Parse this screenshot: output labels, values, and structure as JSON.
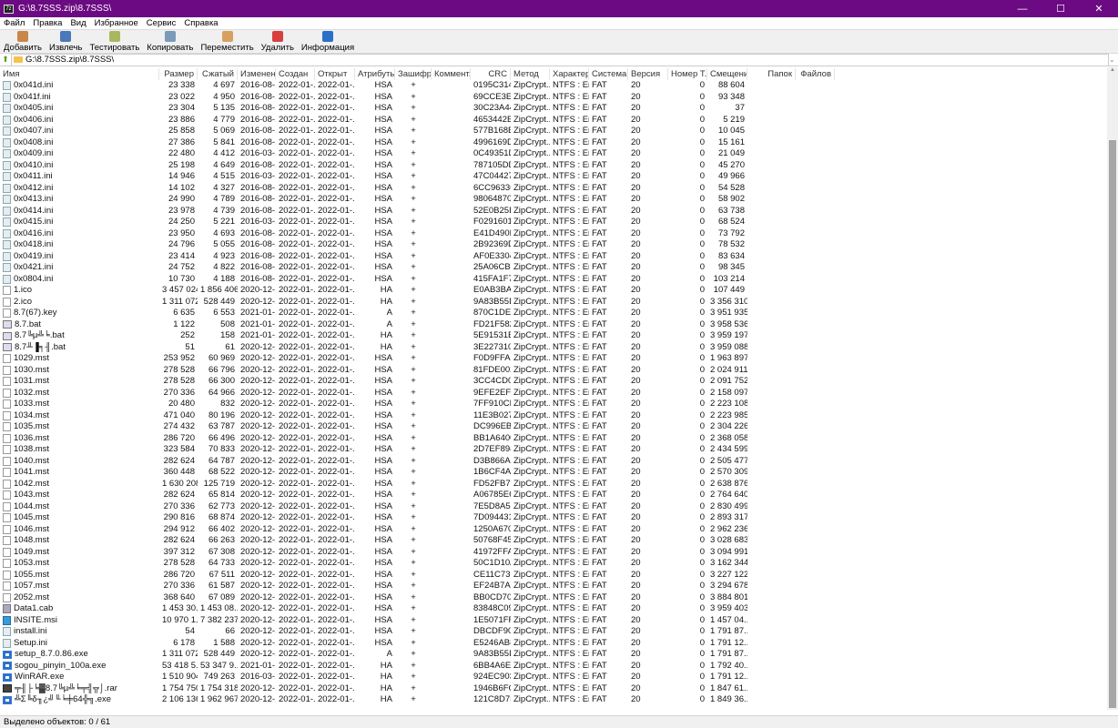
{
  "window": {
    "title": "G:\\8.7SSS.zip\\8.7SSS\\",
    "minimize": "—",
    "maximize": "☐",
    "close": "✕"
  },
  "menu": [
    "Файл",
    "Правка",
    "Вид",
    "Избранное",
    "Сервис",
    "Справка"
  ],
  "toolbar": [
    {
      "label": "Добавить",
      "icon": "add-icon",
      "color": "#c8864a"
    },
    {
      "label": "Извлечь",
      "icon": "extract-icon",
      "color": "#4a78b8"
    },
    {
      "label": "Тестировать",
      "icon": "test-icon",
      "color": "#a8b860"
    },
    {
      "label": "Копировать",
      "icon": "copy-icon",
      "color": "#7a9ab8"
    },
    {
      "label": "Переместить",
      "icon": "move-icon",
      "color": "#d8a060"
    },
    {
      "label": "Удалить",
      "icon": "delete-icon",
      "color": "#d84040"
    },
    {
      "label": "Информация",
      "icon": "info-icon",
      "color": "#2a70c8"
    }
  ],
  "address": {
    "path": "G:\\8.7SSS.zip\\8.7SSS\\"
  },
  "columns": [
    "Имя",
    "Размер",
    "Сжатый",
    "Изменен",
    "Создан",
    "Открыт",
    "Атрибуты",
    "Зашифр...",
    "Коммент...",
    "CRC",
    "Метод",
    "Характер...",
    "Система",
    "Версия",
    "Номер Т...",
    "Смещение",
    "Папок",
    "Файлов"
  ],
  "common": {
    "encrypted": "+",
    "method": "ZipCrypt...",
    "characteristics": "NTFS : En...",
    "host_os": "FAT",
    "version": "20",
    "volume": "0",
    "created": "2022-01-...",
    "accessed": "2022-01-..."
  },
  "rows": [
    [
      "ini",
      "0x041d.ini",
      "23 338",
      "4 697",
      "2016-08-...",
      "HSA",
      "0195C314",
      "88 604"
    ],
    [
      "ini",
      "0x041f.ini",
      "23 022",
      "4 950",
      "2016-08-...",
      "HSA",
      "69CCE3ED",
      "93 348"
    ],
    [
      "ini",
      "0x0405.ini",
      "23 304",
      "5 135",
      "2016-08-...",
      "HSA",
      "30C23A44",
      "37"
    ],
    [
      "ini",
      "0x0406.ini",
      "23 886",
      "4 779",
      "2016-08-...",
      "HSA",
      "4653442B",
      "5 219"
    ],
    [
      "ini",
      "0x0407.ini",
      "25 858",
      "5 069",
      "2016-08-...",
      "HSA",
      "577B168E",
      "10 045"
    ],
    [
      "ini",
      "0x0408.ini",
      "27 386",
      "5 841",
      "2016-08-...",
      "HSA",
      "4996169D",
      "15 161"
    ],
    [
      "ini",
      "0x0409.ini",
      "22 480",
      "4 412",
      "2016-03-...",
      "HSA",
      "0C49351D",
      "21 049"
    ],
    [
      "ini",
      "0x0410.ini",
      "25 198",
      "4 649",
      "2016-08-...",
      "HSA",
      "787105DD",
      "45 270"
    ],
    [
      "ini",
      "0x0411.ini",
      "14 946",
      "4 515",
      "2016-03-...",
      "HSA",
      "47C04427",
      "49 966"
    ],
    [
      "ini",
      "0x0412.ini",
      "14 102",
      "4 327",
      "2016-08-...",
      "HSA",
      "6CC96336",
      "54 528"
    ],
    [
      "ini",
      "0x0413.ini",
      "24 990",
      "4 789",
      "2016-08-...",
      "HSA",
      "98064870",
      "58 902"
    ],
    [
      "ini",
      "0x0414.ini",
      "23 978",
      "4 739",
      "2016-08-...",
      "HSA",
      "52E0B25D",
      "63 738"
    ],
    [
      "ini",
      "0x0415.ini",
      "24 250",
      "5 221",
      "2016-03-...",
      "HSA",
      "F0291601",
      "68 524"
    ],
    [
      "ini",
      "0x0416.ini",
      "23 950",
      "4 693",
      "2016-08-...",
      "HSA",
      "E41D490D",
      "73 792"
    ],
    [
      "ini",
      "0x0418.ini",
      "24 796",
      "5 055",
      "2016-08-...",
      "HSA",
      "2B92369D",
      "78 532"
    ],
    [
      "ini",
      "0x0419.ini",
      "23 414",
      "4 923",
      "2016-08-...",
      "HSA",
      "AF0E3304",
      "83 634"
    ],
    [
      "ini",
      "0x0421.ini",
      "24 752",
      "4 822",
      "2016-08-...",
      "HSA",
      "25A06CB3",
      "98 345"
    ],
    [
      "ini",
      "0x0804.ini",
      "10 730",
      "4 188",
      "2016-08-...",
      "HSA",
      "415FA1F7",
      "103 214"
    ],
    [
      "doc",
      "1.ico",
      "3 457 024",
      "1 856 406",
      "2020-12-...",
      "HA",
      "E0AB3BA9",
      "107 449"
    ],
    [
      "doc",
      "2.ico",
      "1 311 072",
      "528 449",
      "2020-12-...",
      "HA",
      "9A83B55D",
      "3 356 310"
    ],
    [
      "doc",
      "8.7(67).key",
      "6 635",
      "6 553",
      "2021-01-...",
      "A",
      "870C1DE2",
      "3 951 935"
    ],
    [
      "bat",
      "8.7.bat",
      "1 122",
      "508",
      "2021-01-...",
      "A",
      "FD21F582",
      "3 958 536"
    ],
    [
      "bat",
      "8.7╚µ╩╘.bat",
      "252",
      "158",
      "2021-01-...",
      "HA",
      "5E91531E",
      "3 959 197"
    ],
    [
      "bat",
      "8.7╨▐╕╢.bat",
      "51",
      "61",
      "2020-12-...",
      "HA",
      "3E227310",
      "3 959 088"
    ],
    [
      "doc",
      "1029.mst",
      "253 952",
      "60 969",
      "2020-12-...",
      "HSA",
      "F0D9FFA7",
      "1 963 897"
    ],
    [
      "doc",
      "1030.mst",
      "278 528",
      "66 796",
      "2020-12-...",
      "HSA",
      "81FDE002",
      "2 024 911"
    ],
    [
      "doc",
      "1031.mst",
      "278 528",
      "66 300",
      "2020-12-...",
      "HSA",
      "3CC4CD05",
      "2 091 752"
    ],
    [
      "doc",
      "1032.mst",
      "270 336",
      "64 966",
      "2020-12-...",
      "HSA",
      "9EFE2EFC",
      "2 158 097"
    ],
    [
      "doc",
      "1033.mst",
      "20 480",
      "832",
      "2020-12-...",
      "HSA",
      "7FF910CB",
      "2 223 108"
    ],
    [
      "doc",
      "1034.mst",
      "471 040",
      "80 196",
      "2020-12-...",
      "HSA",
      "11E3B027",
      "2 223 985"
    ],
    [
      "doc",
      "1035.mst",
      "274 432",
      "63 787",
      "2020-12-...",
      "HSA",
      "DC996EB0",
      "2 304 226"
    ],
    [
      "doc",
      "1036.mst",
      "286 720",
      "66 496",
      "2020-12-...",
      "HSA",
      "BB1A6400",
      "2 368 058"
    ],
    [
      "doc",
      "1038.mst",
      "323 584",
      "70 833",
      "2020-12-...",
      "HSA",
      "2D7EF894",
      "2 434 599"
    ],
    [
      "doc",
      "1040.mst",
      "282 624",
      "64 787",
      "2020-12-...",
      "HSA",
      "D3B866A0",
      "2 505 477"
    ],
    [
      "doc",
      "1041.mst",
      "360 448",
      "68 522",
      "2020-12-...",
      "HSA",
      "1B6CF4AD",
      "2 570 309"
    ],
    [
      "doc",
      "1042.mst",
      "1 630 208",
      "125 719",
      "2020-12-...",
      "HSA",
      "FD52FB78",
      "2 638 876"
    ],
    [
      "doc",
      "1043.mst",
      "282 624",
      "65 814",
      "2020-12-...",
      "HSA",
      "A06785E6",
      "2 764 640"
    ],
    [
      "doc",
      "1044.mst",
      "270 336",
      "62 773",
      "2020-12-...",
      "HSA",
      "7E5D8A5E",
      "2 830 499"
    ],
    [
      "doc",
      "1045.mst",
      "290 816",
      "68 874",
      "2020-12-...",
      "HSA",
      "7D094431",
      "2 893 317"
    ],
    [
      "doc",
      "1046.mst",
      "294 912",
      "66 402",
      "2020-12-...",
      "HSA",
      "1250A670",
      "2 962 236"
    ],
    [
      "doc",
      "1048.mst",
      "282 624",
      "66 263",
      "2020-12-...",
      "HSA",
      "50768F45",
      "3 028 683"
    ],
    [
      "doc",
      "1049.mst",
      "397 312",
      "67 308",
      "2020-12-...",
      "HSA",
      "41972FFA",
      "3 094 991"
    ],
    [
      "doc",
      "1053.mst",
      "278 528",
      "64 733",
      "2020-12-...",
      "HSA",
      "50C1D10A",
      "3 162 344"
    ],
    [
      "doc",
      "1055.mst",
      "286 720",
      "67 511",
      "2020-12-...",
      "HSA",
      "CE11C73E",
      "3 227 122"
    ],
    [
      "doc",
      "1057.mst",
      "270 336",
      "61 587",
      "2020-12-...",
      "HSA",
      "EF24B7A1",
      "3 294 678"
    ],
    [
      "doc",
      "2052.mst",
      "368 640",
      "67 089",
      "2020-12-...",
      "HSA",
      "BB0CD705",
      "3 884 801"
    ],
    [
      "cab",
      "Data1.cab",
      "1 453 30...",
      "1 453 08...",
      "2020-12-...",
      "HSA",
      "83848C09",
      "3 959 403"
    ],
    [
      "msi",
      "INSITE.msi",
      "10 970 1...",
      "7 382 237",
      "2020-12-...",
      "HSA",
      "1E5071FF",
      "1 457 04..."
    ],
    [
      "ini",
      "install.ini",
      "54",
      "66",
      "2020-12-...",
      "HSA",
      "DBCDF90...",
      "1 791 87..."
    ],
    [
      "ini",
      "Setup.ini",
      "6 178",
      "1 588",
      "2020-12-...",
      "HSA",
      "E5246AB8",
      "1 791 12..."
    ],
    [
      "exe",
      "setup_8.7.0.86.exe",
      "1 311 072",
      "528 449",
      "2020-12-...",
      "A",
      "9A83B55D",
      "1 791 87..."
    ],
    [
      "exe",
      "sogou_pinyin_100a.exe",
      "53 418 5...",
      "53 347 9...",
      "2021-01-...",
      "HA",
      "6BB4A6E3",
      "1 792 40..."
    ],
    [
      "exe",
      "WinRAR.exe",
      "1 510 904",
      "749 263",
      "2016-03-...",
      "HA",
      "924EC903",
      "1 791 12..."
    ],
    [
      "rar",
      "╤╢├╘▓8.7╚µ╩╘╤╣╦⌡.rar",
      "1 754 750",
      "1 754 318",
      "2020-12-...",
      "HA",
      "1946B6FC",
      "1 847 61..."
    ],
    [
      "exe",
      "╩Σ╚δ╖¿╝╙╘╪64╬╗.exe",
      "2 106 136",
      "1 962 967",
      "2020-12-...",
      "HA",
      "121C8D7E",
      "1 849 36..."
    ]
  ],
  "status": {
    "text": "Выделено объектов: 0 / 61"
  }
}
